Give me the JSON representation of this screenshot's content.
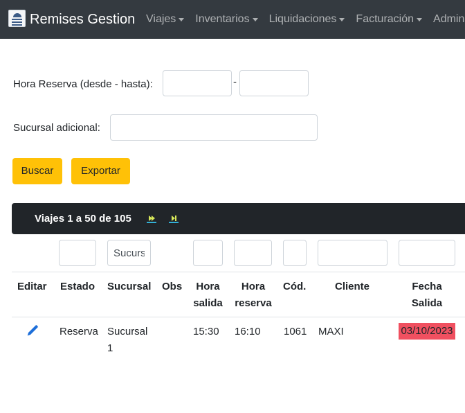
{
  "navbar": {
    "brand": "Remises Gestion",
    "logo_icon": "remises-logo-icon",
    "items": [
      {
        "label": "Viajes"
      },
      {
        "label": "Inventarios"
      },
      {
        "label": "Liquidaciones"
      },
      {
        "label": "Facturación"
      },
      {
        "label": "Administ"
      }
    ]
  },
  "form": {
    "hora_reserva_label": "Hora Reserva (desde - hasta):",
    "hora_desde_value": "",
    "hora_hasta_value": "",
    "range_separator": "-",
    "sucursal_adicional_label": "Sucursal adicional:",
    "sucursal_adicional_value": "",
    "buscar_label": "Buscar",
    "exportar_label": "Exportar"
  },
  "table": {
    "pager_text": "Viajes 1 a 50 de 105",
    "pager_next_icon": "next-page-icon",
    "pager_last_icon": "last-page-icon",
    "filters": {
      "sucursal_value": "Sucursal"
    },
    "headers": {
      "editar": "Editar",
      "estado": "Estado",
      "sucursal": "Sucursal",
      "obs": "Obs",
      "hora_salida_1": "Hora",
      "hora_salida_2": "salida",
      "hora_reserva_1": "Hora",
      "hora_reserva_2": "reserva",
      "cod": "Cód.",
      "cliente": "Cliente",
      "fecha_salida_1": "Fecha",
      "fecha_salida_2": "Salida"
    },
    "rows": [
      {
        "edit_icon": "pencil-icon",
        "estado": "Reserva",
        "sucursal_1": "Sucursal",
        "sucursal_2": "1",
        "obs": "",
        "hora_salida": "15:30",
        "hora_reserva": "16:10",
        "cod": "1061",
        "cliente": "MAXI",
        "fecha_salida": "03/10/2023"
      }
    ]
  },
  "colors": {
    "navbar_bg": "#343a40",
    "button_yellow": "#ffc107",
    "table_bar_bg": "#212529",
    "date_highlight": "#f05060",
    "pencil_blue": "#1e6fd9"
  }
}
